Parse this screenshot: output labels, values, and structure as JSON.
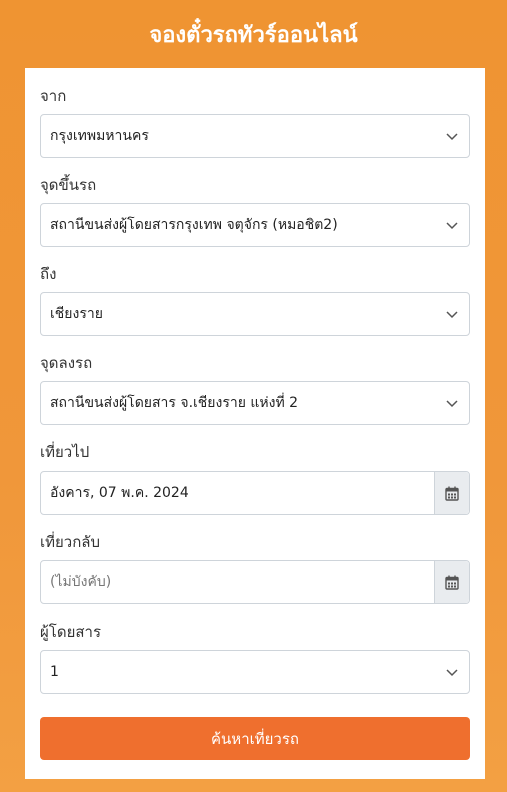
{
  "header": {
    "title": "จองตั๋วรถทัวร์ออนไลน์"
  },
  "form": {
    "from": {
      "label": "จาก",
      "value": "กรุงเทพมหานคร"
    },
    "pickup": {
      "label": "จุดขึ้นรถ",
      "value": "สถานีขนส่งผู้โดยสารกรุงเทพ จตุจักร (หมอชิต2)"
    },
    "to": {
      "label": "ถึง",
      "value": "เชียงราย"
    },
    "dropoff": {
      "label": "จุดลงรถ",
      "value": "สถานีขนส่งผู้โดยสาร จ.เชียงราย แห่งที่ 2"
    },
    "depart": {
      "label": "เที่ยวไป",
      "value": "อังคาร, 07 พ.ค. 2024"
    },
    "return": {
      "label": "เที่ยวกลับ",
      "placeholder": "(ไม่บังคับ)"
    },
    "passengers": {
      "label": "ผู้โดยสาร",
      "value": "1"
    },
    "search_label": "ค้นหาเที่ยวรถ"
  },
  "colors": {
    "background": "#ef9432",
    "button": "#ef6f2e",
    "addon": "#e9ecef"
  },
  "icons": {
    "dropdown": "chevron-down-icon",
    "calendar": "calendar-icon"
  }
}
